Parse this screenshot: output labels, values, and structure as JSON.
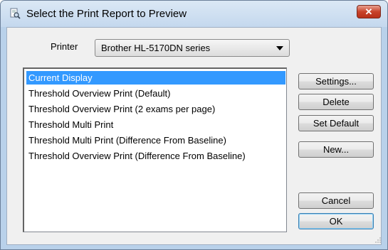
{
  "window": {
    "title": "Select the Print Report to Preview",
    "close_label": "✕"
  },
  "printer": {
    "label": "Printer",
    "selected": "Brother HL-5170DN series"
  },
  "reports": [
    "Current Display",
    "Threshold Overview Print (Default)",
    "Threshold Overview Print (2 exams per page)",
    "Threshold Multi Print",
    "Threshold Multi Print (Difference From Baseline)",
    "Threshold Overview Print (Difference From Baseline)"
  ],
  "selected_report": "Current Display",
  "buttons": {
    "settings": "Settings...",
    "delete": "Delete",
    "set_default": "Set Default",
    "new": "New...",
    "cancel": "Cancel",
    "ok": "OK"
  },
  "colors": {
    "selection": "#3399ff",
    "close_button": "#c8432b"
  },
  "icons": {
    "title_icon": "print-preview-icon",
    "dropdown": "chevron-down-icon",
    "resize": "resize-grip-icon"
  }
}
